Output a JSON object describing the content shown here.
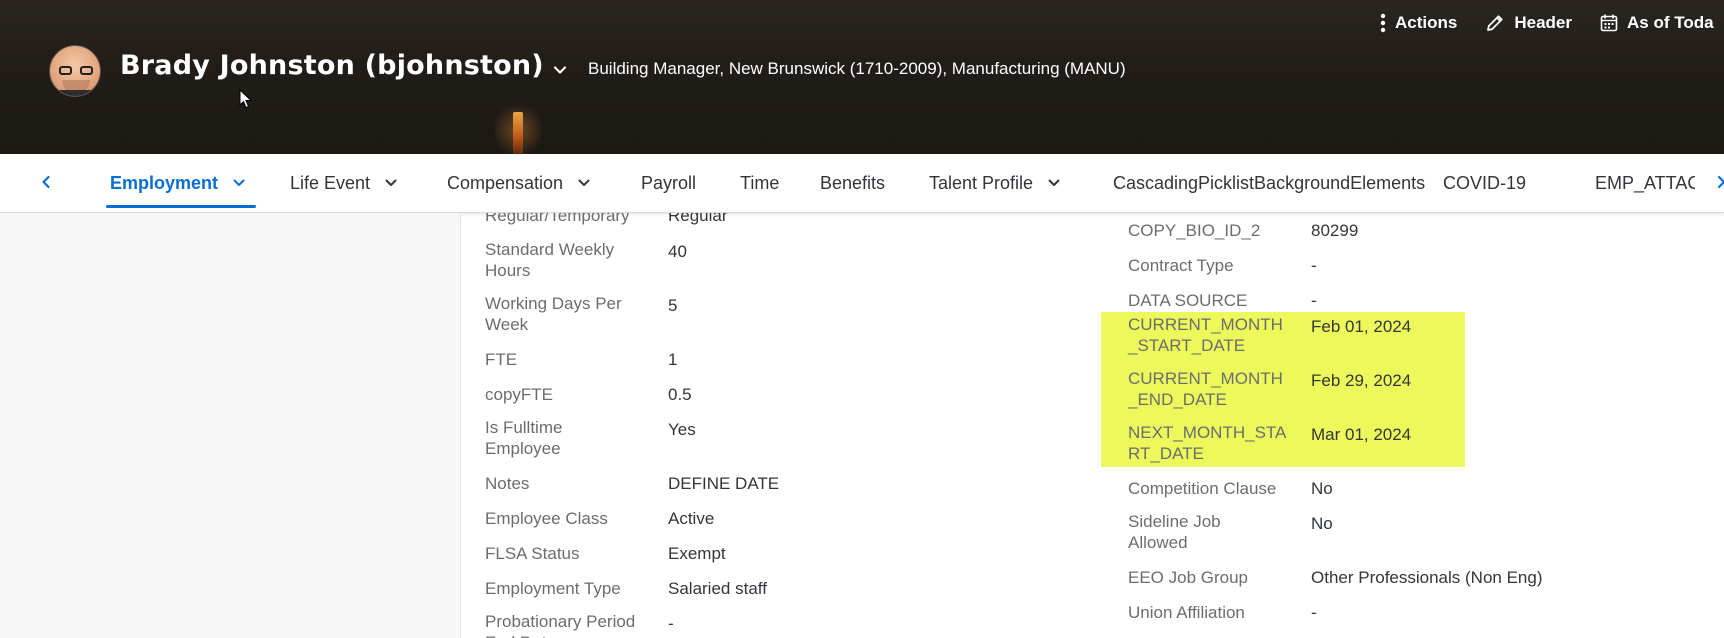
{
  "header": {
    "person_name": "Brady Johnston (bjohnston)",
    "subtitle": "Building Manager, New Brunswick (1710-2009), Manufacturing (MANU)",
    "actions": [
      {
        "label": "Actions",
        "icon": "more-vertical-icon"
      },
      {
        "label": "Header",
        "icon": "pencil-icon"
      },
      {
        "label": "As of Toda",
        "icon": "calendar-icon"
      }
    ]
  },
  "tabs": [
    {
      "label": "Employment",
      "active": true,
      "has_menu": true
    },
    {
      "label": "Life Event",
      "has_menu": true
    },
    {
      "label": "Compensation",
      "has_menu": true
    },
    {
      "label": "Payroll"
    },
    {
      "label": "Time"
    },
    {
      "label": "Benefits"
    },
    {
      "label": "Talent Profile",
      "has_menu": true
    },
    {
      "label": "CascadingPicklistBackgroundElements"
    },
    {
      "label": "COVID-19"
    },
    {
      "label": "EMP_ATTAC"
    }
  ],
  "left_fields": [
    {
      "label": "Regular/Temporary",
      "value": "Regular"
    },
    {
      "label": "Standard Weekly Hours",
      "value": "40"
    },
    {
      "label": "Working Days Per Week",
      "value": "5"
    },
    {
      "label": "FTE",
      "value": "1"
    },
    {
      "label": "copyFTE",
      "value": "0.5"
    },
    {
      "label": "Is Fulltime Employee",
      "value": "Yes"
    },
    {
      "label": "Notes",
      "value": "DEFINE DATE"
    },
    {
      "label": "Employee Class",
      "value": "Active"
    },
    {
      "label": "FLSA Status",
      "value": "Exempt"
    },
    {
      "label": "Employment Type",
      "value": "Salaried staff"
    },
    {
      "label": "Probationary Period End Date",
      "value": "-"
    }
  ],
  "right_fields": [
    {
      "label": "COPY_BIO_ID_2",
      "value": "80299"
    },
    {
      "label": "Contract Type",
      "value": "-"
    },
    {
      "label": "DATA SOURCE",
      "value": "-"
    },
    {
      "label": "CURRENT_MONTH_START_DATE",
      "label_lines": [
        "CURRENT_MONTH",
        "_START_DATE"
      ],
      "value": "Feb 01, 2024"
    },
    {
      "label": "CURRENT_MONTH_END_DATE",
      "label_lines": [
        "CURRENT_MONTH",
        "_END_DATE"
      ],
      "value": "Feb 29, 2024"
    },
    {
      "label": "NEXT_MONTH_START_DATE",
      "label_lines": [
        "NEXT_MONTH_STA",
        "RT_DATE"
      ],
      "value": "Mar 01, 2024"
    },
    {
      "label": "Competition Clause",
      "value": "No"
    },
    {
      "label": "Sideline Job Allowed",
      "value": "No"
    },
    {
      "label": "EEO Job Group",
      "value": "Other Professionals (Non Eng)"
    },
    {
      "label": "Union Affiliation",
      "value": "-"
    }
  ],
  "colors": {
    "accent": "#0a6ed1",
    "highlight": "#edf95a",
    "header_bg": "#221d18"
  }
}
